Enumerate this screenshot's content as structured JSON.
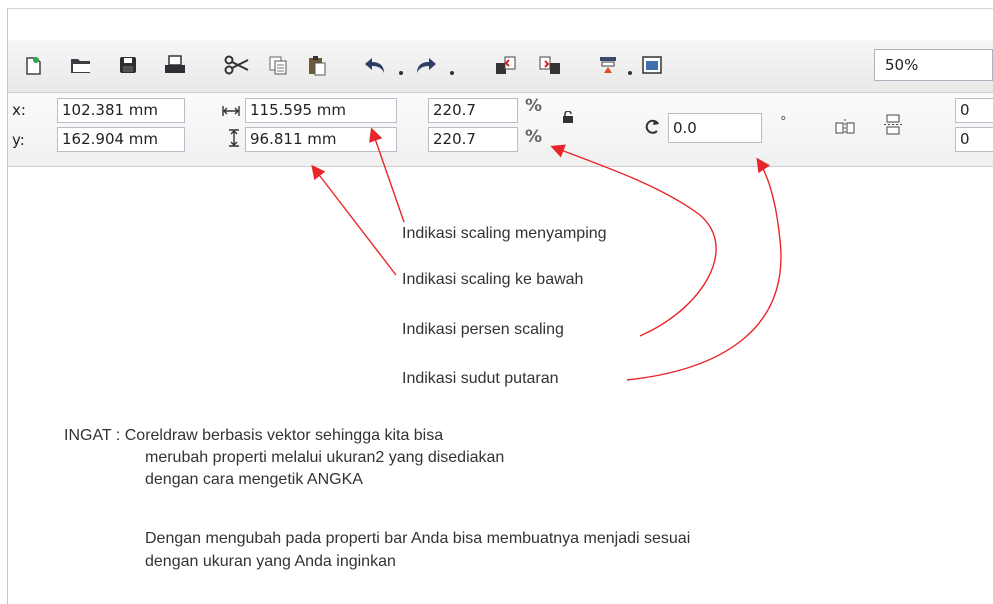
{
  "toolbar": {
    "icons": [
      "new-document-icon",
      "open-folder-icon",
      "save-icon",
      "print-icon",
      "cut-icon",
      "copy-icon",
      "paste-icon",
      "undo-icon",
      "redo-icon",
      "import-icon",
      "export-icon",
      "application-launcher-icon",
      "welcome-screen-icon"
    ],
    "zoom_level": "50%"
  },
  "property_bar": {
    "x_label": "x:",
    "y_label": "y:",
    "x_value": "102.381 mm",
    "y_value": "162.904 mm",
    "width_value": "115.595 mm",
    "height_value": "96.811 mm",
    "scale_x": "220.7",
    "scale_y": "220.7",
    "percent_symbol": "%",
    "rotation_value": "0.0",
    "degree_symbol": "°",
    "right_field_1": "0",
    "right_field_2": "0"
  },
  "annotations": {
    "scaling_horizontal": "Indikasi scaling menyamping",
    "scaling_vertical": "Indikasi scaling ke bawah",
    "scaling_percent": "Indikasi persen scaling",
    "rotation_angle": "Indikasi sudut putaran"
  },
  "notes": {
    "line1": "INGAT : Coreldraw berbasis vektor sehingga kita bisa",
    "line2": "merubah properti melalui ukuran2 yang disediakan",
    "line3": "dengan cara mengetik ANGKA",
    "line4": "Dengan mengubah pada properti bar Anda bisa membuatnya menjadi sesuai",
    "line5": "dengan ukuran yang Anda inginkan"
  },
  "colors": {
    "arrow": "#e8262a",
    "text": "#333333"
  }
}
